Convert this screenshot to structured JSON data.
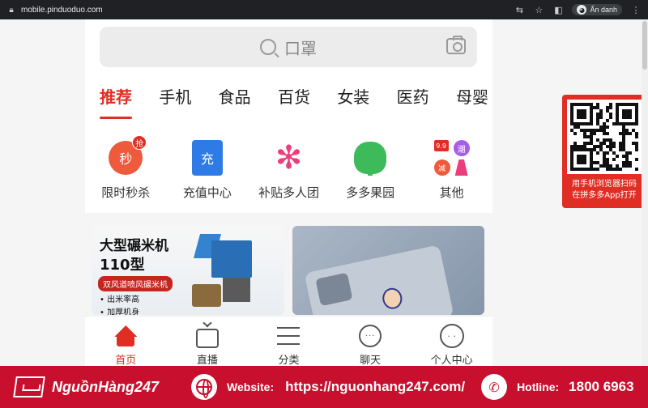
{
  "browser": {
    "url": "mobile.pinduoduo.com",
    "profile_label": "Ẩn danh"
  },
  "search": {
    "placeholder": "口罩"
  },
  "category_tabs": [
    "推荐",
    "手机",
    "食品",
    "百货",
    "女装",
    "医药",
    "母婴"
  ],
  "quick_entries": [
    {
      "label": "限时秒杀",
      "icon": "seckill-icon",
      "glyph": "秒",
      "badge": "抢"
    },
    {
      "label": "充值中心",
      "icon": "topup-icon",
      "glyph": "充"
    },
    {
      "label": "补贴多人团",
      "icon": "group-buy-icon"
    },
    {
      "label": "多多果园",
      "icon": "orchard-tree-icon"
    },
    {
      "label": "其他",
      "icon": "other-icon",
      "b1": "9.9",
      "b2": "潮",
      "b3": "减"
    }
  ],
  "banners": {
    "left": {
      "title": "大型碾米机",
      "subtitle": "110型",
      "pill": "双风道喷风碾米机",
      "line1": "• 出米率高",
      "line2": "• 加厚机身"
    }
  },
  "tabbar": [
    {
      "label": "首页",
      "icon": "home-icon"
    },
    {
      "label": "直播",
      "icon": "live-tv-icon"
    },
    {
      "label": "分类",
      "icon": "category-list-icon"
    },
    {
      "label": "聊天",
      "icon": "chat-icon",
      "glyph": "···"
    },
    {
      "label": "个人中心",
      "icon": "profile-icon",
      "glyph": "· ·"
    }
  ],
  "qr_panel": {
    "line1": "用手机浏览器扫码",
    "line2": "在拼多多App打开"
  },
  "footer": {
    "brand": "NguồnHàng247",
    "website_label": "Website:",
    "website_url": "https://nguonhang247.com/",
    "hotline_label": "Hotline:",
    "hotline_number": "1800 6963"
  },
  "colors": {
    "accent": "#e02e24",
    "footer_bg": "#c8102e"
  }
}
